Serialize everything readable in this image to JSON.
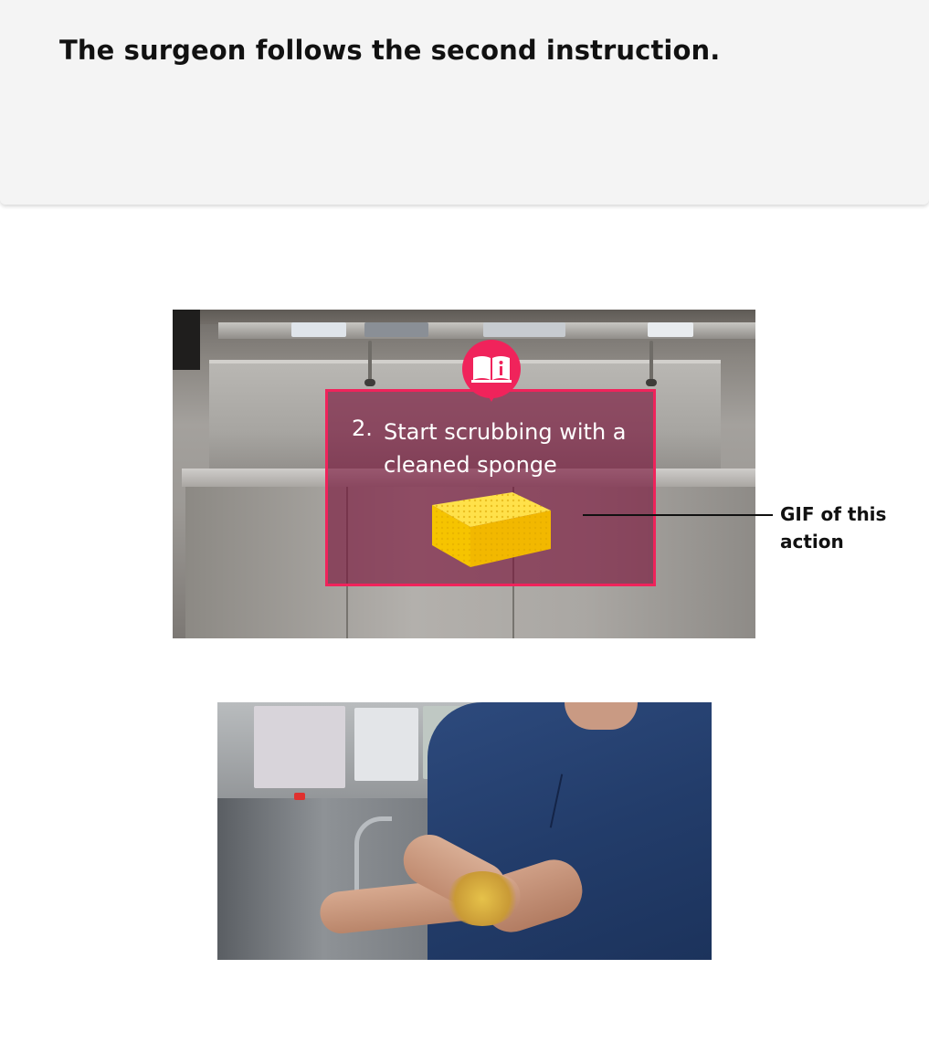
{
  "header": {
    "title": "The surgeon follows the second instruction."
  },
  "instruction_card": {
    "icon": "book-info-icon",
    "number": "2.",
    "text": "Start scrubbing with a cleaned sponge",
    "image": "sponge"
  },
  "callout": {
    "label": "GIF of this action"
  },
  "colors": {
    "accent": "#f0235b",
    "header_bg": "#f4f4f4",
    "overlay_bg": "#780f37"
  }
}
